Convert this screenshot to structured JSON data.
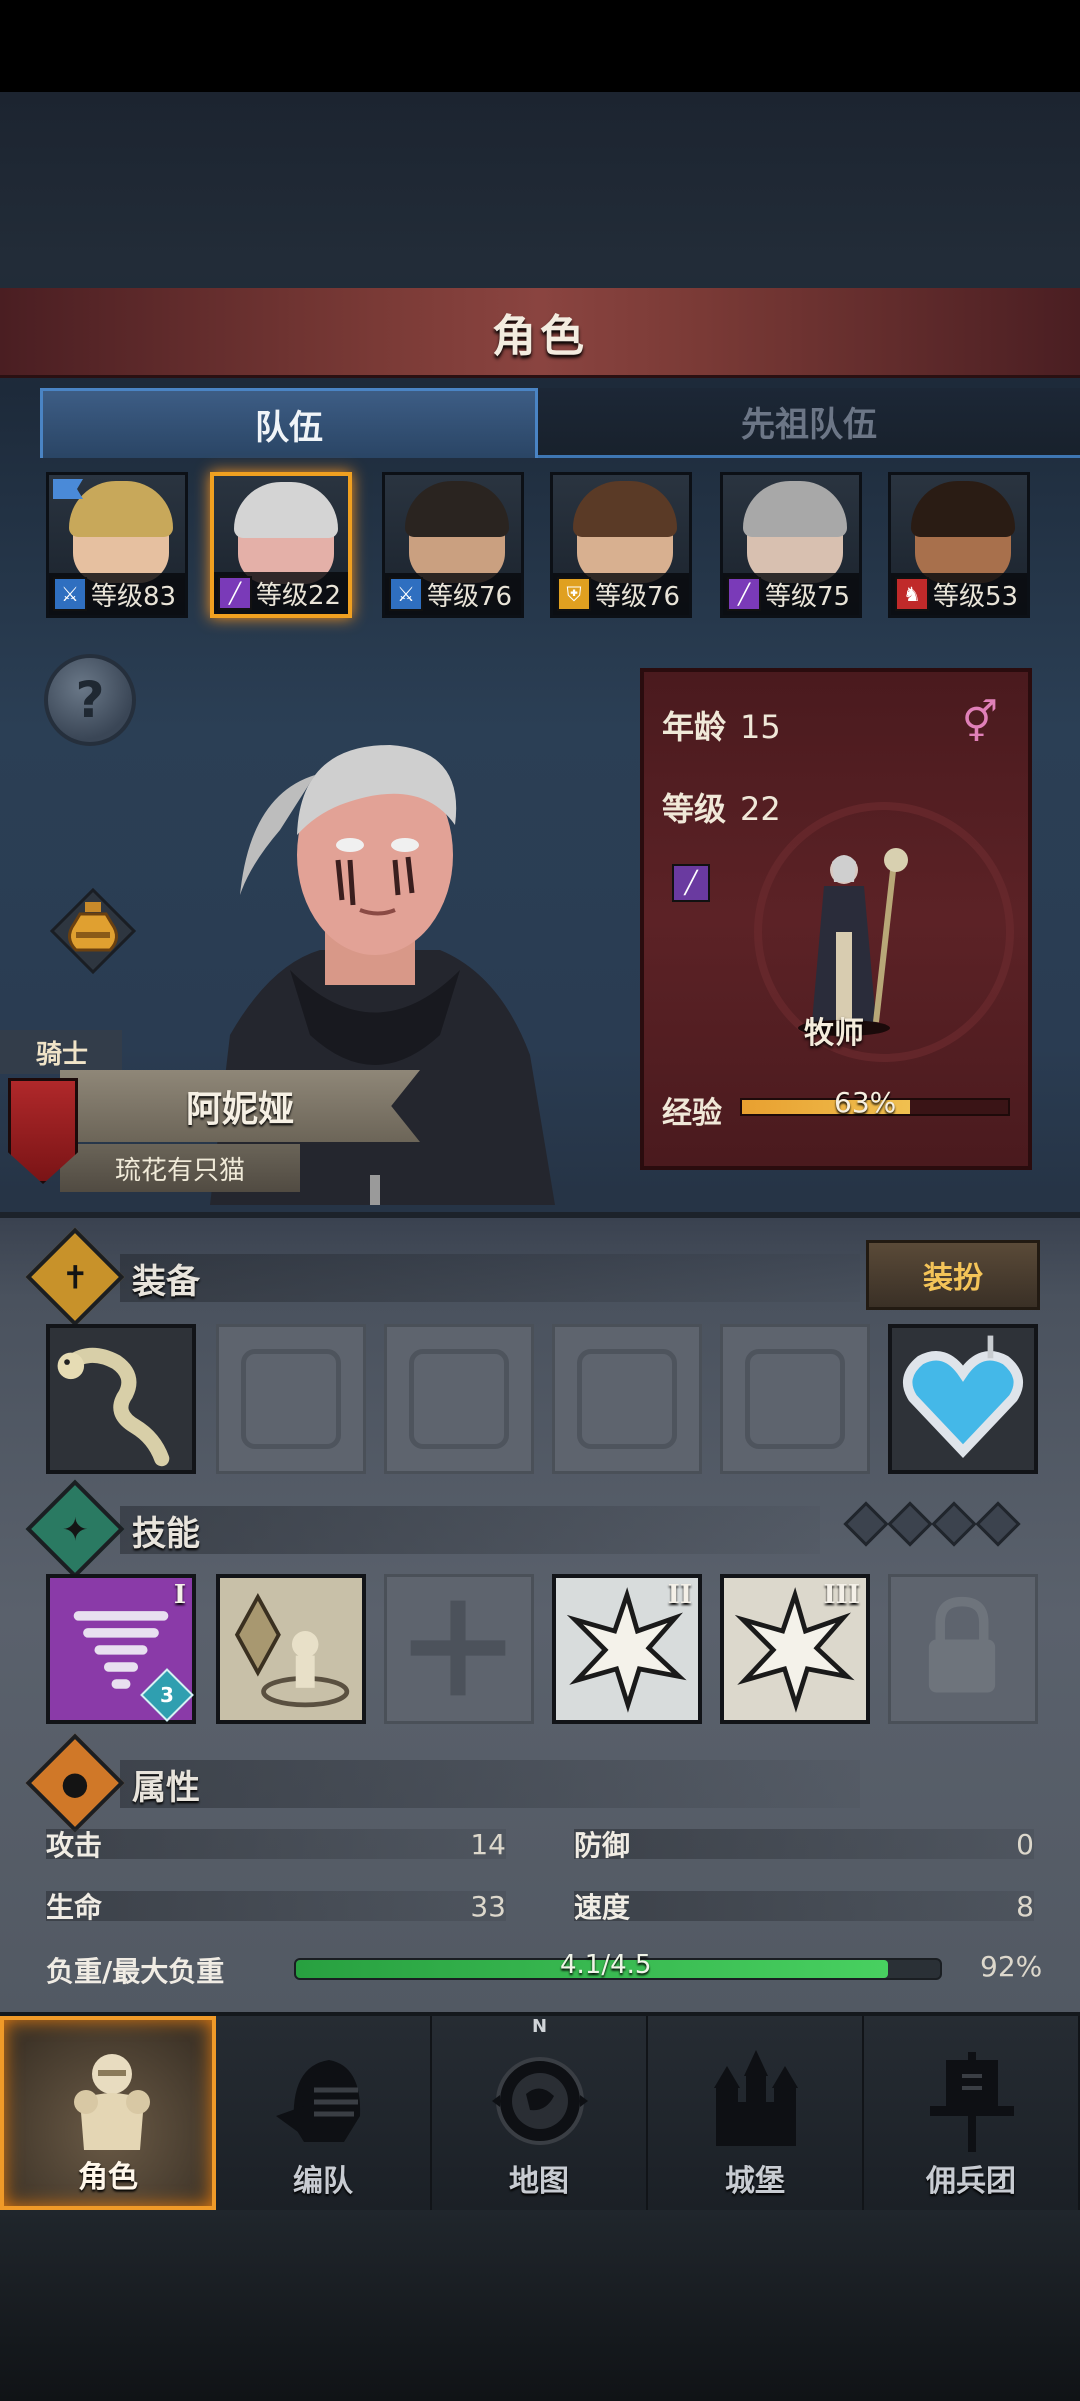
{
  "title": "角色",
  "tabs": [
    {
      "label": "队伍",
      "active": true
    },
    {
      "label": "先祖队伍",
      "active": false
    }
  ],
  "roster": [
    {
      "level": "等级83",
      "class_icon": "sword-icon",
      "class_color": "#2f6fc0",
      "hair": "#c8a85a",
      "skin": "#e6c0a0",
      "selected": false,
      "flag": true
    },
    {
      "level": "等级22",
      "class_icon": "staff-icon",
      "class_color": "#7a3ab8",
      "hair": "#d4d4d4",
      "skin": "#e4b0a8",
      "selected": true,
      "flag": false
    },
    {
      "level": "等级76",
      "class_icon": "sword-icon",
      "class_color": "#2f6fc0",
      "hair": "#2a2420",
      "skin": "#caa080",
      "selected": false,
      "flag": false
    },
    {
      "level": "等级76",
      "class_icon": "shield-icon",
      "class_color": "#e0a020",
      "hair": "#5a3a26",
      "skin": "#d8b090",
      "selected": false,
      "flag": false
    },
    {
      "level": "等级75",
      "class_icon": "staff-icon",
      "class_color": "#7a3ab8",
      "hair": "#a8a8a8",
      "skin": "#d8c0b0",
      "selected": false,
      "flag": false
    },
    {
      "level": "等级53",
      "class_icon": "wolf-icon",
      "class_color": "#c02a2a",
      "hair": "#2a1c14",
      "skin": "#a8704c",
      "selected": false,
      "flag": false
    }
  ],
  "help_label": "?",
  "hero": {
    "class_tag": "骑士",
    "name": "阿妮娅",
    "subtitle": "琉花有只猫"
  },
  "card": {
    "age_label": "年龄",
    "age_value": "15",
    "level_label": "等级",
    "level_value": "22",
    "gender_symbol": "⚥",
    "class_name": "牧师",
    "exp_label": "经验",
    "exp_text": "63%",
    "exp_fraction": 0.63
  },
  "equipment": {
    "title": "装备",
    "dress_button": "装扮",
    "slots": [
      {
        "name": "weapon-slot",
        "filled": true
      },
      {
        "name": "shield-slot",
        "filled": false
      },
      {
        "name": "helmet-slot",
        "filled": false
      },
      {
        "name": "armor-slot",
        "filled": false
      },
      {
        "name": "boots-slot",
        "filled": false
      },
      {
        "name": "amulet-slot",
        "filled": true
      }
    ]
  },
  "skills": {
    "title": "技能",
    "slots": [
      {
        "name": "tornado-skill",
        "tier": "I",
        "badge": "3",
        "bg": "#8a3aa8"
      },
      {
        "name": "crystal-skill",
        "tier": "",
        "badge": "",
        "bg": "#c8c0a8"
      },
      {
        "name": "cross-skill",
        "tier": "",
        "badge": "",
        "bg": ""
      },
      {
        "name": "burst-skill-2",
        "tier": "II",
        "badge": "",
        "bg": "#d8dcdc"
      },
      {
        "name": "burst-skill-3",
        "tier": "III",
        "badge": "",
        "bg": "#dcd8cc"
      },
      {
        "name": "locked-skill",
        "tier": "",
        "badge": "",
        "bg": ""
      }
    ]
  },
  "attributes": {
    "title": "属性",
    "attack_label": "攻击",
    "attack_value": "14",
    "defense_label": "防御",
    "defense_value": "0",
    "hp_label": "生命",
    "hp_value": "33",
    "speed_label": "速度",
    "speed_value": "8",
    "load_label": "负重/最大负重",
    "load_text": "4.1/4.5",
    "load_percent": "92%",
    "load_fraction": 0.92
  },
  "nav": [
    {
      "label": "角色",
      "icon": "knight-icon",
      "active": true
    },
    {
      "label": "编队",
      "icon": "helmet-icon",
      "active": false
    },
    {
      "label": "地图",
      "icon": "compass-map-icon",
      "active": false,
      "north": "N"
    },
    {
      "label": "城堡",
      "icon": "castle-icon",
      "active": false
    },
    {
      "label": "佣兵团",
      "icon": "banner-icon",
      "active": false
    }
  ],
  "colors": {
    "accent_orange": "#f09a28",
    "tab_blue": "#4a84c4",
    "card_red": "#5c2226",
    "exp_gold": "#f0c050",
    "load_green": "#48d060"
  }
}
